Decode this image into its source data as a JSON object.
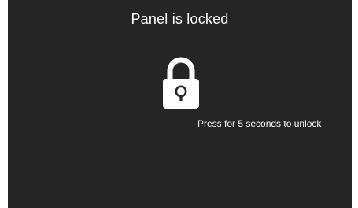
{
  "panel": {
    "title": "Panel is locked",
    "hint": "Press for 5 seconds to unlock",
    "lock_icon": "padlock-icon",
    "colors": {
      "background": "#252525",
      "foreground": "#ffffff",
      "frame": "#ffffff"
    }
  }
}
